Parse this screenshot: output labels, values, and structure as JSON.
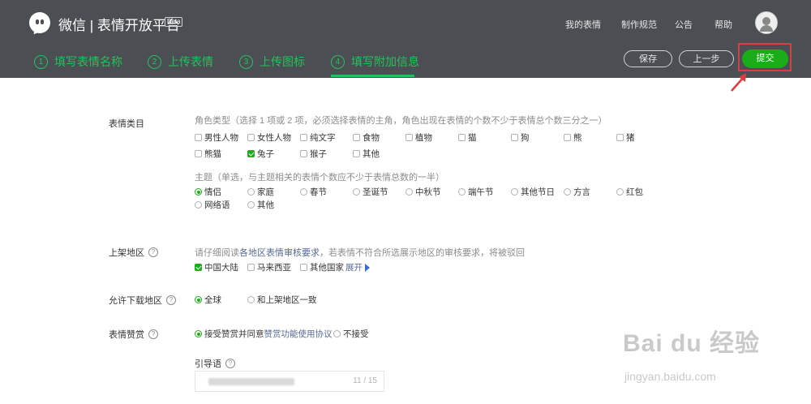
{
  "header": {
    "brand": "微信 | 表情开放平台",
    "beta": "Beta",
    "links": [
      "我的表情",
      "制作规范",
      "公告",
      "帮助"
    ]
  },
  "steps": [
    {
      "num": "1",
      "label": "填写表情名称"
    },
    {
      "num": "2",
      "label": "上传表情"
    },
    {
      "num": "3",
      "label": "上传图标"
    },
    {
      "num": "4",
      "label": "填写附加信息"
    }
  ],
  "actions": {
    "save": "保存",
    "prev": "上一步",
    "submit": "提交"
  },
  "category": {
    "label": "表情类目",
    "role_hint": "角色类型（选择 1 项或 2 项，必须选择表情的主角，角色出现在表情的个数不少于表情总个数三分之一）",
    "roles": [
      {
        "label": "男性人物",
        "checked": false
      },
      {
        "label": "女性人物",
        "checked": false
      },
      {
        "label": "纯文字",
        "checked": false
      },
      {
        "label": "食物",
        "checked": false
      },
      {
        "label": "植物",
        "checked": false
      },
      {
        "label": "猫",
        "checked": false
      },
      {
        "label": "狗",
        "checked": false
      },
      {
        "label": "熊",
        "checked": false
      },
      {
        "label": "猪",
        "checked": false
      },
      {
        "label": "熊猫",
        "checked": false
      },
      {
        "label": "兔子",
        "checked": true
      },
      {
        "label": "猴子",
        "checked": false
      },
      {
        "label": "其他",
        "checked": false
      }
    ],
    "theme_hint": "主题（单选，与主题相关的表情个数应不少于表情总数的一半）",
    "themes": [
      {
        "label": "情侣",
        "checked": true
      },
      {
        "label": "家庭",
        "checked": false
      },
      {
        "label": "春节",
        "checked": false
      },
      {
        "label": "圣诞节",
        "checked": false
      },
      {
        "label": "中秋节",
        "checked": false
      },
      {
        "label": "端午节",
        "checked": false
      },
      {
        "label": "其他节日",
        "checked": false
      },
      {
        "label": "方言",
        "checked": false
      },
      {
        "label": "红包",
        "checked": false
      },
      {
        "label": "网络语",
        "checked": false
      },
      {
        "label": "其他",
        "checked": false
      }
    ]
  },
  "region": {
    "label": "上架地区",
    "hint_prefix": "请仔细阅读",
    "hint_link": "各地区表情审核要求",
    "hint_suffix": "，若表情不符合所选展示地区的审核要求，将被驳回",
    "options": [
      {
        "label": "中国大陆",
        "checked": true
      },
      {
        "label": "马来西亚",
        "checked": false
      },
      {
        "label": "其他国家",
        "checked": false
      }
    ],
    "expand": "展开"
  },
  "download": {
    "label": "允许下载地区",
    "options": [
      {
        "label": "全球",
        "checked": true
      },
      {
        "label": "和上架地区一致",
        "checked": false
      }
    ]
  },
  "reward": {
    "label": "表情赞赏",
    "accept_prefix": "接受赞赏并同意",
    "accept_link": "赞赏功能使用协议",
    "reject": "不接受",
    "guide_label": "引导语",
    "counter": "11 / 15"
  },
  "watermark": {
    "brand": "Bai du 经验",
    "url": "jingyan.baidu.com"
  },
  "colors": {
    "accent": "#1aad19",
    "step_green": "#25c05b",
    "header_bg": "#4b4f53",
    "highlight": "#e0393e",
    "link": "#576b95"
  }
}
